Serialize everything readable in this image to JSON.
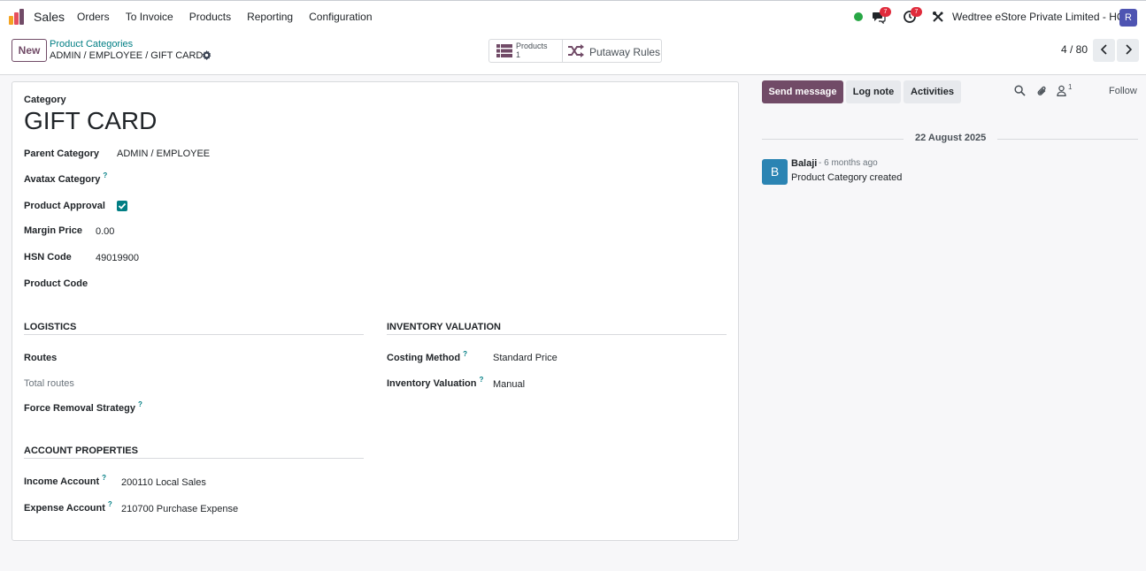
{
  "navbar": {
    "app_name": "Sales",
    "menu": [
      "Orders",
      "To Invoice",
      "Products",
      "Reporting",
      "Configuration"
    ],
    "messages_badge": "7",
    "activities_badge": "7",
    "company": "Wedtree eStore Private Limited - HO",
    "user_initial": "R"
  },
  "control": {
    "new_label": "New",
    "breadcrumb_parent": "Product Categories",
    "breadcrumb_current": "ADMIN / EMPLOYEE / GIFT CARD",
    "smart_products_label": "Products",
    "smart_products_count": "1",
    "smart_putaway_label": "Putaway Rules",
    "pager": "4 / 80"
  },
  "form": {
    "category_label": "Category",
    "name": "GIFT CARD",
    "parent_category_label": "Parent Category",
    "parent_category_value": "ADMIN / EMPLOYEE",
    "avatax_label": "Avatax Category",
    "product_approval_label": "Product Approval",
    "product_approval_checked": true,
    "margin_price_label": "Margin Price",
    "margin_price_value": "0.00",
    "hsn_code_label": "HSN Code",
    "hsn_code_value": "49019900",
    "product_code_label": "Product Code",
    "logistics_title": "LOGISTICS",
    "routes_label": "Routes",
    "total_routes_label": "Total routes",
    "force_removal_label": "Force Removal Strategy",
    "inventory_title": "INVENTORY VALUATION",
    "costing_method_label": "Costing Method",
    "costing_method_value": "Standard Price",
    "inventory_valuation_label": "Inventory Valuation",
    "inventory_valuation_value": "Manual",
    "account_title": "ACCOUNT PROPERTIES",
    "income_account_label": "Income Account",
    "income_account_value": "200110 Local Sales",
    "expense_account_label": "Expense Account",
    "expense_account_value": "210700 Purchase Expense",
    "help_mark": "?"
  },
  "chatter": {
    "send_message": "Send message",
    "log_note": "Log note",
    "activities": "Activities",
    "follower_count": "1",
    "follow": "Follow",
    "date": "22 August 2025",
    "message": {
      "avatar_initial": "B",
      "author": "Balaji",
      "time": "- 6 months ago",
      "body": "Product Category created"
    }
  },
  "colors": {
    "primary": "#714b67",
    "teal": "#017e84",
    "badge": "#e02b3c",
    "avatar_r": "#4e54b2",
    "avatar_b": "#2b84b3"
  }
}
